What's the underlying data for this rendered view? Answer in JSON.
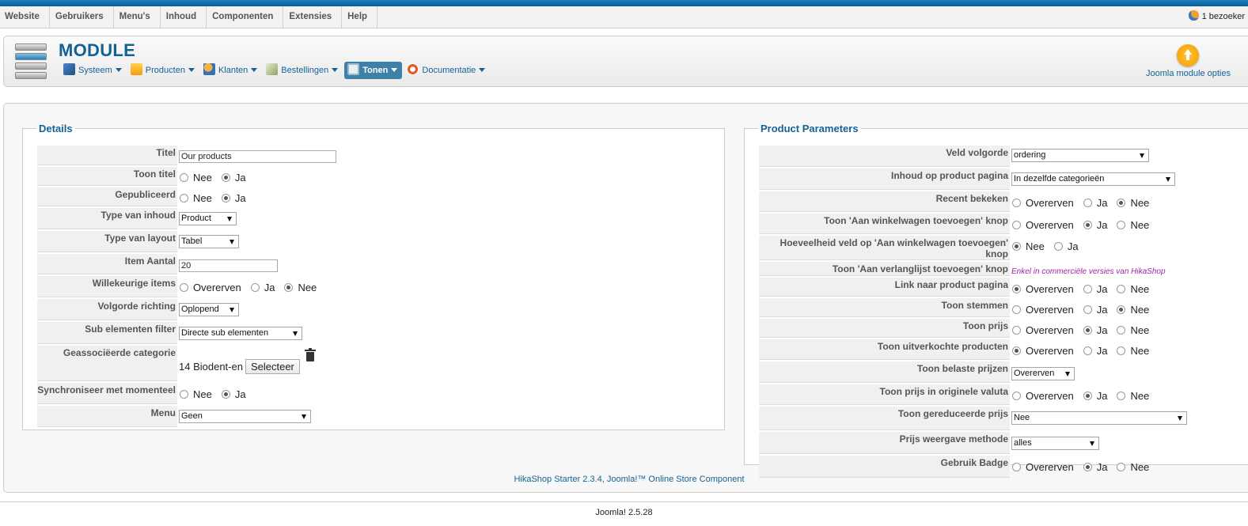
{
  "menu": {
    "items": [
      "Website",
      "Gebruikers",
      "Menu's",
      "Inhoud",
      "Componenten",
      "Extensies",
      "Help"
    ],
    "visitors": "1 bezoeker"
  },
  "header": {
    "title": "MODULE",
    "submenu": [
      {
        "label": "Systeem",
        "icon": "tools-icon",
        "color": "#3a77b8"
      },
      {
        "label": "Producten",
        "icon": "box-icon",
        "color": "#f5a623"
      },
      {
        "label": "Klanten",
        "icon": "users-icon",
        "color": "#e38b1d"
      },
      {
        "label": "Bestellingen",
        "icon": "orders-icon",
        "color": "#8aa35a"
      },
      {
        "label": "Tonen",
        "icon": "display-icon",
        "color": "#e8eef2",
        "active": true
      },
      {
        "label": "Documentatie",
        "icon": "lifebuoy-icon",
        "color": "#e05a2a"
      }
    ],
    "options_label": "Joomla module opties"
  },
  "details": {
    "legend": "Details",
    "titel": {
      "label": "Titel",
      "value": "Our products"
    },
    "toon_titel": {
      "label": "Toon titel",
      "opt1": "Nee",
      "opt2": "Ja"
    },
    "gepubliceerd": {
      "label": "Gepubliceerd",
      "opt1": "Nee",
      "opt2": "Ja"
    },
    "type_inhoud": {
      "label": "Type van inhoud",
      "value": "Product"
    },
    "type_layout": {
      "label": "Type van layout",
      "value": "Tabel"
    },
    "item_aantal": {
      "label": "Item Aantal",
      "value": "20"
    },
    "willekeurig": {
      "label": "Willekeurige items",
      "opt1": "Overerven",
      "opt2": "Ja",
      "opt3": "Nee"
    },
    "volgorde": {
      "label": "Volgorde richting",
      "value": "Oplopend"
    },
    "sub_filter": {
      "label": "Sub elementen filter",
      "value": "Directe sub elementen"
    },
    "categorie": {
      "label": "Geassociëerde categorie",
      "value": "14 Biodent-en",
      "button": "Selecteer"
    },
    "sync": {
      "label": "Synchroniseer met momenteel",
      "opt1": "Nee",
      "opt2": "Ja"
    },
    "menu": {
      "label": "Menu",
      "value": "Geen"
    }
  },
  "params": {
    "legend": "Product Parameters",
    "veld_volgorde": {
      "label": "Veld volgorde",
      "value": "ordering"
    },
    "inhoud_pagina": {
      "label": "Inhoud op product pagina",
      "value": "In dezelfde categorieën"
    },
    "recent": {
      "label": "Recent bekeken",
      "opt1": "Overerven",
      "opt2": "Ja",
      "opt3": "Nee"
    },
    "toon_winkelwagen": {
      "label": "Toon 'Aan winkelwagen toevoegen' knop",
      "opt1": "Overerven",
      "opt2": "Ja",
      "opt3": "Nee"
    },
    "hoeveelheid": {
      "label": "Hoeveelheid veld op 'Aan winkelwagen toevoegen' knop",
      "opt1": "Nee",
      "opt2": "Ja"
    },
    "verlanglijst": {
      "label": "Toon 'Aan verlanglijst toevoegen' knop",
      "note": "Enkel in commerciële versies van HikaShop"
    },
    "link": {
      "label": "Link naar product pagina",
      "opt1": "Overerven",
      "opt2": "Ja",
      "opt3": "Nee"
    },
    "stemmen": {
      "label": "Toon stemmen",
      "opt1": "Overerven",
      "opt2": "Ja",
      "opt3": "Nee"
    },
    "prijs": {
      "label": "Toon prijs",
      "opt1": "Overerven",
      "opt2": "Ja",
      "opt3": "Nee"
    },
    "uitverkocht": {
      "label": "Toon uitverkochte producten",
      "opt1": "Overerven",
      "opt2": "Ja",
      "opt3": "Nee"
    },
    "belaste": {
      "label": "Toon belaste prijzen",
      "value": "Overerven"
    },
    "valuta": {
      "label": "Toon prijs in originele valuta",
      "opt1": "Overerven",
      "opt2": "Ja",
      "opt3": "Nee"
    },
    "gereduceerd": {
      "label": "Toon gereduceerde prijs",
      "value": "Nee"
    },
    "weergave": {
      "label": "Prijs weergave methode",
      "value": "alles"
    },
    "badge": {
      "label": "Gebruik Badge",
      "opt1": "Overerven",
      "opt2": "Ja",
      "opt3": "Nee"
    }
  },
  "footer": {
    "component": "HikaShop Starter 2.3.4, Joomla!™ Online Store Component",
    "version": "Joomla! 2.5.28"
  }
}
